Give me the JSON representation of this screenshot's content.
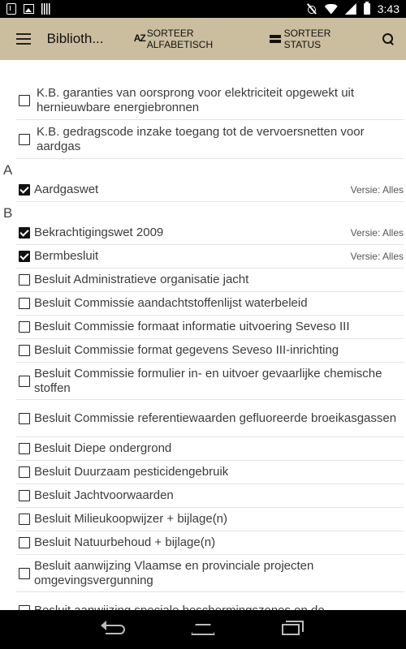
{
  "status_bar": {
    "time": "3:43"
  },
  "toolbar": {
    "title": "Biblioth...",
    "sort_alpha_icon": "AZ",
    "sort_alpha_label": "SORTEER ALFABETISCH",
    "sort_status_label": "SORTEER STATUS"
  },
  "list": {
    "top_items": [
      {
        "label": "K.B. garanties van oorsprong voor elektriciteit opgewekt uit hernieuwbare energiebronnen",
        "checked": false
      },
      {
        "label": "K.B. gedragscode inzake toegang tot de vervoersnetten voor aardgas",
        "checked": false
      }
    ],
    "section_a": {
      "header": "A",
      "items": [
        {
          "label": "Aardgaswet",
          "checked": true,
          "version": "Versie: Alles"
        }
      ]
    },
    "section_b": {
      "header": "B",
      "items": [
        {
          "label": "Bekrachtigingswet 2009",
          "checked": true,
          "version": "Versie: Alles"
        },
        {
          "label": "Bermbesluit",
          "checked": true,
          "version": "Versie: Alles"
        },
        {
          "label": "Besluit Administratieve organisatie jacht",
          "checked": false
        },
        {
          "label": "Besluit Commissie aandachtstoffenlijst waterbeleid",
          "checked": false
        },
        {
          "label": "Besluit Commissie formaat informatie uitvoering Seveso III",
          "checked": false
        },
        {
          "label": "Besluit Commissie format gegevens Seveso III-inrichting",
          "checked": false
        },
        {
          "label": "Besluit Commissie formulier in- en uitvoer gevaarlijke chemische stoffen",
          "checked": false
        },
        {
          "label": "Besluit Commissie referentiewaarden gefluoreerde broeikasgassen",
          "checked": false
        },
        {
          "label": "Besluit Diepe ondergrond",
          "checked": false
        },
        {
          "label": "Besluit Duurzaam pesticidengebruik",
          "checked": false
        },
        {
          "label": "Besluit Jachtvoorwaarden",
          "checked": false
        },
        {
          "label": "Besluit Milieukoopwijzer + bijlage(n)",
          "checked": false
        },
        {
          "label": "Besluit Natuurbehoud + bijlage(n)",
          "checked": false
        },
        {
          "label": "Besluit aanwijzing Vlaamse en provinciale projecten omgevingsvergunning",
          "checked": false
        },
        {
          "label": "Besluit aanwijzing speciale beschermingszones en de",
          "checked": false
        }
      ]
    }
  }
}
